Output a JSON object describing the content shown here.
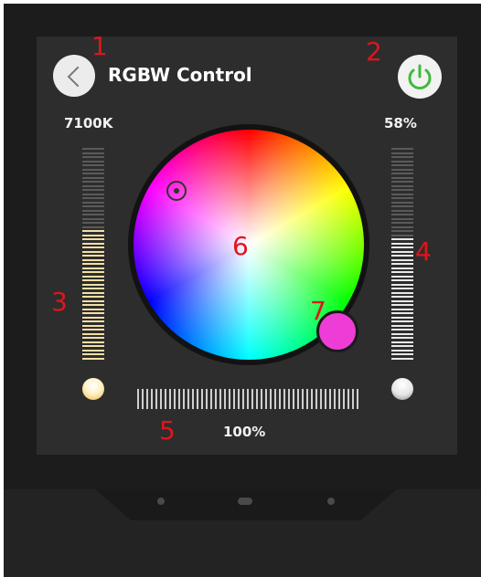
{
  "header": {
    "title": "RGBW Control",
    "back_icon": "chevron-left-icon",
    "power_icon": "power-icon",
    "power_color": "#3dbb3b"
  },
  "temperature": {
    "value": "7100K",
    "level": 0.62
  },
  "brightness": {
    "value": "58%",
    "level": 0.58
  },
  "saturation": {
    "value": "100%",
    "level": 1.0
  },
  "wheel": {
    "selected_color": "#ee3dd6"
  },
  "annotations": [
    "1",
    "2",
    "3",
    "4",
    "5",
    "6",
    "7"
  ]
}
